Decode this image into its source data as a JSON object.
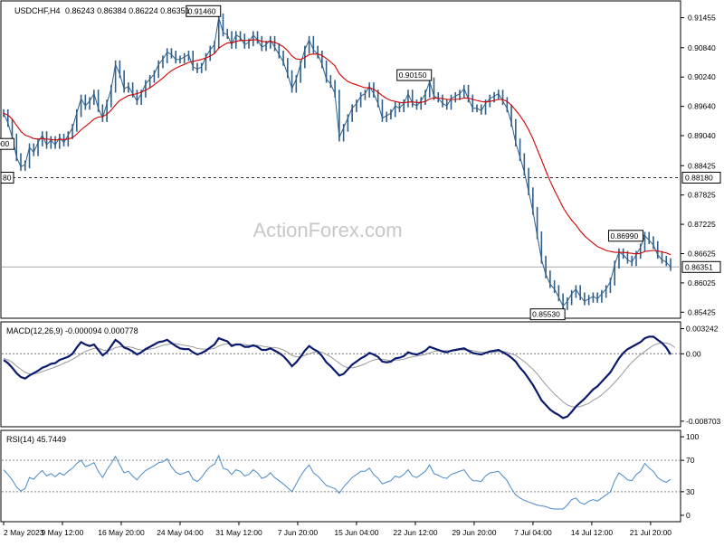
{
  "header": {
    "symbol_label": "USDCHF,H4",
    "ohlc": "0.86243 0.86384 0.86224 0.86351"
  },
  "watermark": "ActionForex.com",
  "colors": {
    "price": "#2f5f8a",
    "ma": "#d40000",
    "macd": "#0a1a6e",
    "signal": "#999999",
    "rsi": "#4a8ac9",
    "grid": "#888888"
  },
  "chart_data": [
    {
      "type": "line",
      "panel": "price",
      "ylim": [
        0.8532,
        0.9178
      ],
      "y_ticks": [
        "0.91455",
        "0.90840",
        "0.90240",
        "0.89640",
        "0.89040",
        "0.88425",
        "0.87825",
        "0.87225",
        "0.86625",
        "0.86025",
        "0.85425"
      ],
      "x_tick_labels": [
        "2 May 2023",
        "9 May 12:00",
        "16 May 20:00",
        "24 May 04:00",
        "31 May 12:00",
        "7 Jun 20:00",
        "15 Jun 04:00",
        "22 Jun 12:00",
        "29 Jun 20:00",
        "7 Jul 04:00",
        "14 Jul 12:00",
        "21 Jul 20:00"
      ],
      "last_price": 0.86351,
      "last_price_label": "0.86351",
      "horizontal_level": 0.8818,
      "horizontal_level_label": "0.88180",
      "horizontal_level_left_label": "80",
      "annotations": [
        {
          "text": "0.91460",
          "value": 0.9146
        },
        {
          "text": "0.89000",
          "value": 0.89
        },
        {
          "text": "0.90150",
          "value": 0.9015
        },
        {
          "text": "0.86990",
          "value": 0.8699
        },
        {
          "text": "0.85530",
          "value": 0.8553
        }
      ],
      "series": [
        {
          "values": [
            0.895,
            0.893,
            0.89,
            0.886,
            0.884,
            0.8845,
            0.888,
            0.887,
            0.889,
            0.8905,
            0.8885,
            0.8895,
            0.8885,
            0.89,
            0.889,
            0.8905,
            0.892,
            0.895,
            0.898,
            0.8965,
            0.8975,
            0.899,
            0.896,
            0.894,
            0.897,
            0.9,
            0.905,
            0.903,
            0.9,
            0.9005,
            0.899,
            0.8975,
            0.899,
            0.901,
            0.902,
            0.903,
            0.905,
            0.906,
            0.9075,
            0.907,
            0.906,
            0.906,
            0.9065,
            0.907,
            0.9045,
            0.904,
            0.9045,
            0.9065,
            0.908,
            0.909,
            0.9146,
            0.9115,
            0.911,
            0.909,
            0.911,
            0.9105,
            0.909,
            0.9095,
            0.911,
            0.91,
            0.9085,
            0.909,
            0.91,
            0.9085,
            0.907,
            0.9055,
            0.903,
            0.9,
            0.902,
            0.905,
            0.908,
            0.91,
            0.908,
            0.907,
            0.905,
            0.902,
            0.901,
            0.899,
            0.89,
            0.892,
            0.894,
            0.896,
            0.897,
            0.8985,
            0.899,
            0.9005,
            0.899,
            0.897,
            0.894,
            0.8945,
            0.895,
            0.8965,
            0.896,
            0.897,
            0.899,
            0.897,
            0.8965,
            0.8975,
            0.899,
            0.9015,
            0.8985,
            0.898,
            0.897,
            0.8965,
            0.898,
            0.8985,
            0.899,
            0.9,
            0.898,
            0.896,
            0.896,
            0.8955,
            0.897,
            0.898,
            0.8985,
            0.899,
            0.8975,
            0.896,
            0.893,
            0.889,
            0.886,
            0.883,
            0.879,
            0.875,
            0.87,
            0.865,
            0.862,
            0.86,
            0.859,
            0.8573,
            0.8555,
            0.8565,
            0.858,
            0.859,
            0.8575,
            0.8565,
            0.857,
            0.8575,
            0.857,
            0.858,
            0.859,
            0.8605,
            0.864,
            0.8665,
            0.866,
            0.865,
            0.8645,
            0.866,
            0.8675,
            0.8699,
            0.869,
            0.868,
            0.866,
            0.865,
            0.8645,
            0.86351
          ]
        },
        {
          "name": "MA",
          "values": [
            0.895,
            0.8946,
            0.8938,
            0.8925,
            0.8913,
            0.8905,
            0.8902,
            0.8898,
            0.8897,
            0.8898,
            0.8897,
            0.8896,
            0.8895,
            0.8896,
            0.8896,
            0.8897,
            0.89,
            0.8907,
            0.8916,
            0.8923,
            0.893,
            0.8938,
            0.8942,
            0.8943,
            0.8948,
            0.8956,
            0.8967,
            0.8976,
            0.8981,
            0.8986,
            0.8988,
            0.899,
            0.8993,
            0.8997,
            0.9002,
            0.9008,
            0.9015,
            0.9022,
            0.903,
            0.9037,
            0.9042,
            0.9046,
            0.905,
            0.9054,
            0.9056,
            0.9058,
            0.906,
            0.9063,
            0.9067,
            0.9072,
            0.9083,
            0.9089,
            0.9094,
            0.9094,
            0.9097,
            0.9099,
            0.9099,
            0.9099,
            0.91,
            0.91,
            0.9097,
            0.9096,
            0.9097,
            0.9095,
            0.9091,
            0.9086,
            0.9078,
            0.9067,
            0.9061,
            0.906,
            0.9064,
            0.907,
            0.9071,
            0.9071,
            0.9068,
            0.9062,
            0.9055,
            0.9047,
            0.9031,
            0.9022,
            0.9015,
            0.9011,
            0.9008,
            0.9005,
            0.9002,
            0.9002,
            0.8999,
            0.8993,
            0.8986,
            0.898,
            0.8976,
            0.8974,
            0.8972,
            0.8971,
            0.8973,
            0.8973,
            0.8972,
            0.8972,
            0.8974,
            0.8979,
            0.8981,
            0.8981,
            0.898,
            0.8978,
            0.8978,
            0.8978,
            0.8979,
            0.8981,
            0.8981,
            0.8978,
            0.8976,
            0.8974,
            0.8973,
            0.8974,
            0.8976,
            0.8978,
            0.8978,
            0.8974,
            0.8966,
            0.8956,
            0.8945,
            0.8932,
            0.8916,
            0.8898,
            0.8876,
            0.8854,
            0.8832,
            0.8811,
            0.8792,
            0.8775,
            0.8757,
            0.8743,
            0.8731,
            0.8721,
            0.8709,
            0.8699,
            0.8691,
            0.8684,
            0.8677,
            0.8673,
            0.8669,
            0.8667,
            0.8665,
            0.8665,
            0.8665,
            0.8664,
            0.8663,
            0.8662,
            0.8663,
            0.8667,
            0.8668,
            0.8669,
            0.8668,
            0.8666,
            0.8664,
            0.866
          ]
        }
      ]
    },
    {
      "type": "line",
      "panel": "macd",
      "label": "MACD(12,26,9) -0.000094 0.000778",
      "ylim": [
        -0.0093,
        0.004
      ],
      "y_ticks": [
        "0.003242",
        "0.00",
        "-0.008703"
      ],
      "series": [
        {
          "name": "MACD",
          "values": [
            -0.0008,
            -0.0012,
            -0.0018,
            -0.0025,
            -0.003,
            -0.0032,
            -0.0028,
            -0.0025,
            -0.0022,
            -0.0018,
            -0.0016,
            -0.0013,
            -0.0012,
            -0.0008,
            -0.0006,
            -0.0004,
            0.0,
            0.0008,
            0.0015,
            0.0012,
            0.001,
            0.0012,
            0.0005,
            -0.0002,
            0.0002,
            0.001,
            0.0018,
            0.0014,
            0.0008,
            0.0006,
            0.0003,
            -0.0001,
            0.0002,
            0.0006,
            0.0009,
            0.0012,
            0.0015,
            0.0016,
            0.0018,
            0.0014,
            0.001,
            0.0007,
            0.0006,
            0.0006,
            0.0002,
            -0.0001,
            0.0001,
            0.0004,
            0.0008,
            0.0012,
            0.002,
            0.0018,
            0.0016,
            0.001,
            0.0012,
            0.0012,
            0.0009,
            0.0009,
            0.0011,
            0.0009,
            0.0005,
            0.0005,
            0.0007,
            0.0004,
            0.0001,
            -0.0003,
            -0.0009,
            -0.0016,
            -0.0011,
            -0.0004,
            0.0004,
            0.001,
            0.0006,
            0.0003,
            -0.0003,
            -0.0011,
            -0.0016,
            -0.0022,
            -0.0028,
            -0.0026,
            -0.002,
            -0.0014,
            -0.001,
            -0.0006,
            -0.0003,
            0.0001,
            -0.0001,
            -0.0004,
            -0.001,
            -0.0011,
            -0.001,
            -0.0006,
            -0.0005,
            -0.0003,
            0.0002,
            0.0,
            -0.0001,
            0.0001,
            0.0004,
            0.0009,
            0.0007,
            0.0005,
            0.0003,
            0.0002,
            0.0004,
            0.0005,
            0.0006,
            0.0007,
            0.0004,
            0.0001,
            0.0,
            -0.0001,
            0.0001,
            0.0003,
            0.0004,
            0.0005,
            0.0002,
            -0.0001,
            -0.0005,
            -0.001,
            -0.0018,
            -0.0024,
            -0.0032,
            -0.004,
            -0.005,
            -0.006,
            -0.0066,
            -0.0072,
            -0.0076,
            -0.0079,
            -0.0083,
            -0.0081,
            -0.0075,
            -0.0068,
            -0.0063,
            -0.0058,
            -0.0052,
            -0.0046,
            -0.0042,
            -0.0036,
            -0.003,
            -0.0024,
            -0.0015,
            -0.0006,
            0.0001,
            0.0006,
            0.0009,
            0.0012,
            0.0015,
            0.002,
            0.0022,
            0.0022,
            0.0018,
            0.0014,
            0.0008,
            -0.0001
          ]
        },
        {
          "name": "Signal",
          "values": [
            -0.0006,
            -0.0008,
            -0.0011,
            -0.0016,
            -0.002,
            -0.0024,
            -0.0026,
            -0.0026,
            -0.0025,
            -0.0023,
            -0.0021,
            -0.0019,
            -0.0017,
            -0.0015,
            -0.0012,
            -0.001,
            -0.0007,
            -0.0004,
            0.0,
            0.0003,
            0.0005,
            0.0007,
            0.0007,
            0.0005,
            0.0004,
            0.0005,
            0.0008,
            0.0009,
            0.0009,
            0.0009,
            0.0008,
            0.0006,
            0.0005,
            0.0005,
            0.0006,
            0.0007,
            0.0009,
            0.0011,
            0.0012,
            0.0013,
            0.0013,
            0.0012,
            0.0011,
            0.001,
            0.0009,
            0.0007,
            0.0006,
            0.0006,
            0.0006,
            0.0007,
            0.001,
            0.0012,
            0.0013,
            0.0012,
            0.0012,
            0.0012,
            0.0012,
            0.0011,
            0.0011,
            0.0011,
            0.001,
            0.0009,
            0.0008,
            0.0008,
            0.0007,
            0.0005,
            0.0002,
            -0.0002,
            -0.0004,
            -0.0004,
            -0.0002,
            0.0,
            0.0002,
            0.0003,
            0.0002,
            -0.0001,
            -0.0004,
            -0.0008,
            -0.0012,
            -0.0016,
            -0.0018,
            -0.0018,
            -0.0017,
            -0.0015,
            -0.0013,
            -0.001,
            -0.0008,
            -0.0007,
            -0.0007,
            -0.0008,
            -0.0009,
            -0.0008,
            -0.0008,
            -0.0007,
            -0.0005,
            -0.0004,
            -0.0003,
            -0.0002,
            -0.0001,
            0.0001,
            0.0003,
            0.0004,
            0.0004,
            0.0004,
            0.0004,
            0.0004,
            0.0005,
            0.0005,
            0.0005,
            0.0004,
            0.0003,
            0.0002,
            0.0002,
            0.0002,
            0.0002,
            0.0003,
            0.0003,
            0.0002,
            0.0,
            -0.0002,
            -0.0006,
            -0.001,
            -0.0015,
            -0.002,
            -0.0026,
            -0.0033,
            -0.004,
            -0.0046,
            -0.0052,
            -0.0057,
            -0.0062,
            -0.0066,
            -0.0068,
            -0.0069,
            -0.0068,
            -0.0066,
            -0.0064,
            -0.006,
            -0.0057,
            -0.0053,
            -0.0048,
            -0.0043,
            -0.0037,
            -0.0031,
            -0.0024,
            -0.0017,
            -0.0011,
            -0.0006,
            -0.0001,
            0.0003,
            0.0007,
            0.0011,
            0.0013,
            0.0014,
            0.0014,
            0.0012,
            0.0008
          ]
        }
      ]
    },
    {
      "type": "line",
      "panel": "rsi",
      "label": "RSI(14) 45.7449",
      "ylim": [
        -7,
        107
      ],
      "y_ticks": [
        "100",
        "70",
        "30",
        "0"
      ],
      "levels": [
        70,
        30
      ],
      "series": [
        {
          "name": "RSI",
          "values": [
            58,
            52,
            45,
            36,
            31,
            34,
            48,
            46,
            52,
            57,
            50,
            53,
            49,
            54,
            51,
            56,
            60,
            66,
            70,
            62,
            64,
            67,
            56,
            48,
            58,
            66,
            75,
            64,
            54,
            56,
            50,
            45,
            52,
            57,
            60,
            63,
            67,
            68,
            72,
            62,
            55,
            52,
            54,
            56,
            46,
            43,
            48,
            56,
            62,
            65,
            76,
            60,
            58,
            52,
            58,
            56,
            50,
            52,
            58,
            54,
            47,
            49,
            54,
            48,
            44,
            40,
            35,
            30,
            40,
            50,
            58,
            64,
            54,
            50,
            44,
            38,
            36,
            34,
            28,
            36,
            42,
            48,
            52,
            56,
            56,
            60,
            52,
            47,
            40,
            42,
            44,
            50,
            48,
            52,
            58,
            50,
            48,
            52,
            56,
            64,
            53,
            51,
            48,
            47,
            52,
            54,
            56,
            58,
            50,
            44,
            44,
            43,
            50,
            54,
            55,
            56,
            50,
            44,
            34,
            26,
            22,
            19,
            17,
            15,
            13,
            12,
            11,
            9,
            8,
            8,
            8,
            13,
            20,
            22,
            16,
            14,
            18,
            20,
            18,
            22,
            26,
            30,
            44,
            54,
            50,
            45,
            44,
            52,
            56,
            66,
            60,
            56,
            48,
            44,
            42,
            45.7449
          ]
        }
      ]
    }
  ]
}
